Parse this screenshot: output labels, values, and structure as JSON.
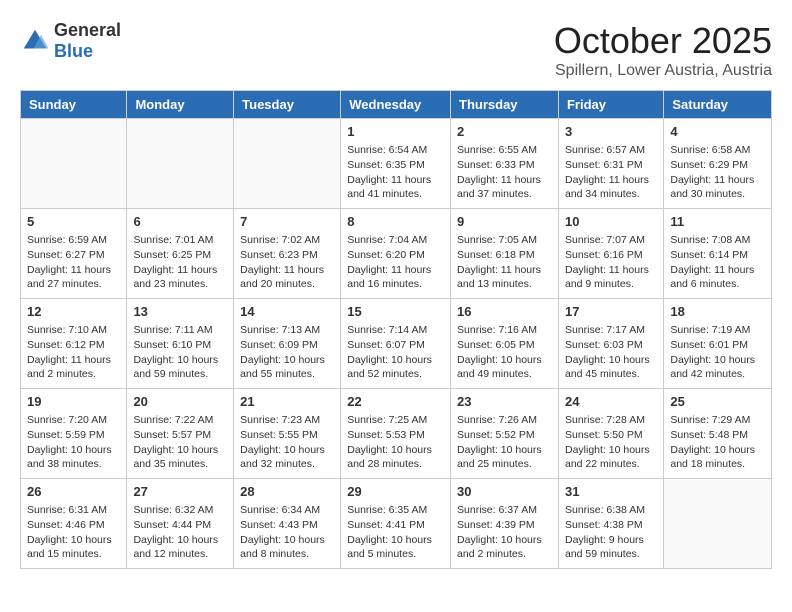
{
  "header": {
    "logo_general": "General",
    "logo_blue": "Blue",
    "month": "October 2025",
    "location": "Spillern, Lower Austria, Austria"
  },
  "days_of_week": [
    "Sunday",
    "Monday",
    "Tuesday",
    "Wednesday",
    "Thursday",
    "Friday",
    "Saturday"
  ],
  "weeks": [
    [
      {
        "day": "",
        "info": ""
      },
      {
        "day": "",
        "info": ""
      },
      {
        "day": "",
        "info": ""
      },
      {
        "day": "1",
        "info": "Sunrise: 6:54 AM\nSunset: 6:35 PM\nDaylight: 11 hours\nand 41 minutes."
      },
      {
        "day": "2",
        "info": "Sunrise: 6:55 AM\nSunset: 6:33 PM\nDaylight: 11 hours\nand 37 minutes."
      },
      {
        "day": "3",
        "info": "Sunrise: 6:57 AM\nSunset: 6:31 PM\nDaylight: 11 hours\nand 34 minutes."
      },
      {
        "day": "4",
        "info": "Sunrise: 6:58 AM\nSunset: 6:29 PM\nDaylight: 11 hours\nand 30 minutes."
      }
    ],
    [
      {
        "day": "5",
        "info": "Sunrise: 6:59 AM\nSunset: 6:27 PM\nDaylight: 11 hours\nand 27 minutes."
      },
      {
        "day": "6",
        "info": "Sunrise: 7:01 AM\nSunset: 6:25 PM\nDaylight: 11 hours\nand 23 minutes."
      },
      {
        "day": "7",
        "info": "Sunrise: 7:02 AM\nSunset: 6:23 PM\nDaylight: 11 hours\nand 20 minutes."
      },
      {
        "day": "8",
        "info": "Sunrise: 7:04 AM\nSunset: 6:20 PM\nDaylight: 11 hours\nand 16 minutes."
      },
      {
        "day": "9",
        "info": "Sunrise: 7:05 AM\nSunset: 6:18 PM\nDaylight: 11 hours\nand 13 minutes."
      },
      {
        "day": "10",
        "info": "Sunrise: 7:07 AM\nSunset: 6:16 PM\nDaylight: 11 hours\nand 9 minutes."
      },
      {
        "day": "11",
        "info": "Sunrise: 7:08 AM\nSunset: 6:14 PM\nDaylight: 11 hours\nand 6 minutes."
      }
    ],
    [
      {
        "day": "12",
        "info": "Sunrise: 7:10 AM\nSunset: 6:12 PM\nDaylight: 11 hours\nand 2 minutes."
      },
      {
        "day": "13",
        "info": "Sunrise: 7:11 AM\nSunset: 6:10 PM\nDaylight: 10 hours\nand 59 minutes."
      },
      {
        "day": "14",
        "info": "Sunrise: 7:13 AM\nSunset: 6:09 PM\nDaylight: 10 hours\nand 55 minutes."
      },
      {
        "day": "15",
        "info": "Sunrise: 7:14 AM\nSunset: 6:07 PM\nDaylight: 10 hours\nand 52 minutes."
      },
      {
        "day": "16",
        "info": "Sunrise: 7:16 AM\nSunset: 6:05 PM\nDaylight: 10 hours\nand 49 minutes."
      },
      {
        "day": "17",
        "info": "Sunrise: 7:17 AM\nSunset: 6:03 PM\nDaylight: 10 hours\nand 45 minutes."
      },
      {
        "day": "18",
        "info": "Sunrise: 7:19 AM\nSunset: 6:01 PM\nDaylight: 10 hours\nand 42 minutes."
      }
    ],
    [
      {
        "day": "19",
        "info": "Sunrise: 7:20 AM\nSunset: 5:59 PM\nDaylight: 10 hours\nand 38 minutes."
      },
      {
        "day": "20",
        "info": "Sunrise: 7:22 AM\nSunset: 5:57 PM\nDaylight: 10 hours\nand 35 minutes."
      },
      {
        "day": "21",
        "info": "Sunrise: 7:23 AM\nSunset: 5:55 PM\nDaylight: 10 hours\nand 32 minutes."
      },
      {
        "day": "22",
        "info": "Sunrise: 7:25 AM\nSunset: 5:53 PM\nDaylight: 10 hours\nand 28 minutes."
      },
      {
        "day": "23",
        "info": "Sunrise: 7:26 AM\nSunset: 5:52 PM\nDaylight: 10 hours\nand 25 minutes."
      },
      {
        "day": "24",
        "info": "Sunrise: 7:28 AM\nSunset: 5:50 PM\nDaylight: 10 hours\nand 22 minutes."
      },
      {
        "day": "25",
        "info": "Sunrise: 7:29 AM\nSunset: 5:48 PM\nDaylight: 10 hours\nand 18 minutes."
      }
    ],
    [
      {
        "day": "26",
        "info": "Sunrise: 6:31 AM\nSunset: 4:46 PM\nDaylight: 10 hours\nand 15 minutes."
      },
      {
        "day": "27",
        "info": "Sunrise: 6:32 AM\nSunset: 4:44 PM\nDaylight: 10 hours\nand 12 minutes."
      },
      {
        "day": "28",
        "info": "Sunrise: 6:34 AM\nSunset: 4:43 PM\nDaylight: 10 hours\nand 8 minutes."
      },
      {
        "day": "29",
        "info": "Sunrise: 6:35 AM\nSunset: 4:41 PM\nDaylight: 10 hours\nand 5 minutes."
      },
      {
        "day": "30",
        "info": "Sunrise: 6:37 AM\nSunset: 4:39 PM\nDaylight: 10 hours\nand 2 minutes."
      },
      {
        "day": "31",
        "info": "Sunrise: 6:38 AM\nSunset: 4:38 PM\nDaylight: 9 hours\nand 59 minutes."
      },
      {
        "day": "",
        "info": ""
      }
    ]
  ]
}
